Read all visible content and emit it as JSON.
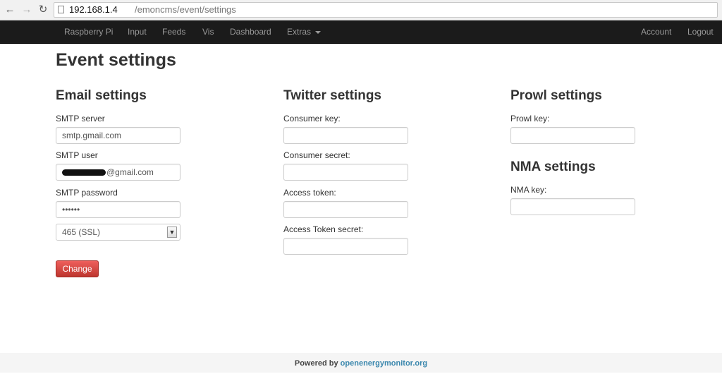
{
  "browser": {
    "url_host": "192.168.1.4",
    "url_path": "/emoncms/event/settings",
    "back_icon": "←",
    "forward_icon": "→",
    "reload_icon": "↻"
  },
  "navbar": {
    "items": [
      "Raspberry Pi",
      "Input",
      "Feeds",
      "Vis",
      "Dashboard",
      "Extras"
    ],
    "right_items": [
      "Account",
      "Logout"
    ]
  },
  "page": {
    "title": "Event settings"
  },
  "email": {
    "title": "Email settings",
    "smtp_server_label": "SMTP server",
    "smtp_server_value": "smtp.gmail.com",
    "smtp_user_label": "SMTP user",
    "smtp_user_value": "@gmail.com",
    "smtp_password_label": "SMTP password",
    "smtp_password_value": "••••••",
    "port_selected": "465 (SSL)",
    "submit_label": "Change"
  },
  "twitter": {
    "title": "Twitter settings",
    "consumer_key_label": "Consumer key:",
    "consumer_secret_label": "Consumer secret:",
    "access_token_label": "Access token:",
    "access_token_secret_label": "Access Token secret:"
  },
  "prowl": {
    "title": "Prowl settings",
    "key_label": "Prowl key:"
  },
  "nma": {
    "title": "NMA settings",
    "key_label": "NMA key:"
  },
  "footer": {
    "powered_by": "Powered by",
    "link": "openenergymonitor.org"
  },
  "colors": {
    "navbar_bg": "#1b1b1b",
    "danger_button": "#bd362f",
    "link": "#3a87ad"
  }
}
